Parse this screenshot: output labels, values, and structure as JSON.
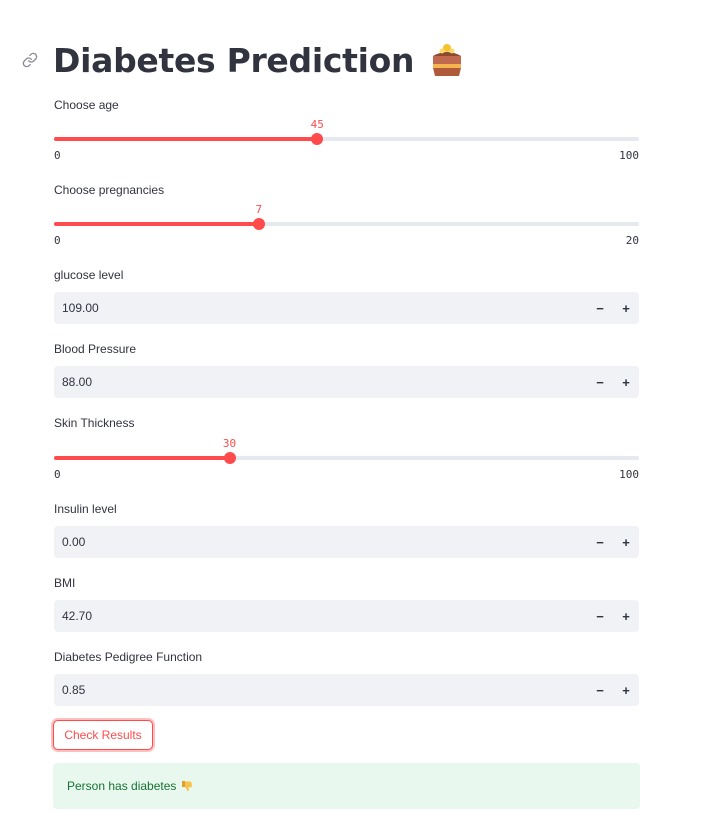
{
  "page": {
    "title": "Diabetes Prediction",
    "title_emoji": "cake-emoji",
    "link_icon": "link-icon"
  },
  "fields": {
    "age": {
      "label": "Choose age",
      "value": "45",
      "value_num": 45,
      "min": "0",
      "max": "100",
      "min_num": 0,
      "max_num": 100
    },
    "pregnancies": {
      "label": "Choose pregnancies",
      "value": "7",
      "value_num": 7,
      "min": "0",
      "max": "20",
      "min_num": 0,
      "max_num": 20
    },
    "glucose": {
      "label": "glucose level",
      "value": "109.00"
    },
    "blood_pressure": {
      "label": "Blood Pressure",
      "value": "88.00"
    },
    "skin_thickness": {
      "label": "Skin Thickness",
      "value": "30",
      "value_num": 30,
      "min": "0",
      "max": "100",
      "min_num": 0,
      "max_num": 100
    },
    "insulin": {
      "label": "Insulin level",
      "value": "0.00"
    },
    "bmi": {
      "label": "BMI",
      "value": "42.70"
    },
    "dpf": {
      "label": "Diabetes Pedigree Function",
      "value": "0.85"
    }
  },
  "stepper": {
    "minus": "−",
    "plus": "+"
  },
  "button": {
    "label": "Check Results"
  },
  "result": {
    "text": "Person has diabetes",
    "icon": "thumbs-down-emoji"
  },
  "colors": {
    "accent": "#ff4b4b",
    "text": "#31333f",
    "input_bg": "#f0f2f6",
    "success_bg": "#e8f8ee",
    "success_text": "#177233"
  }
}
